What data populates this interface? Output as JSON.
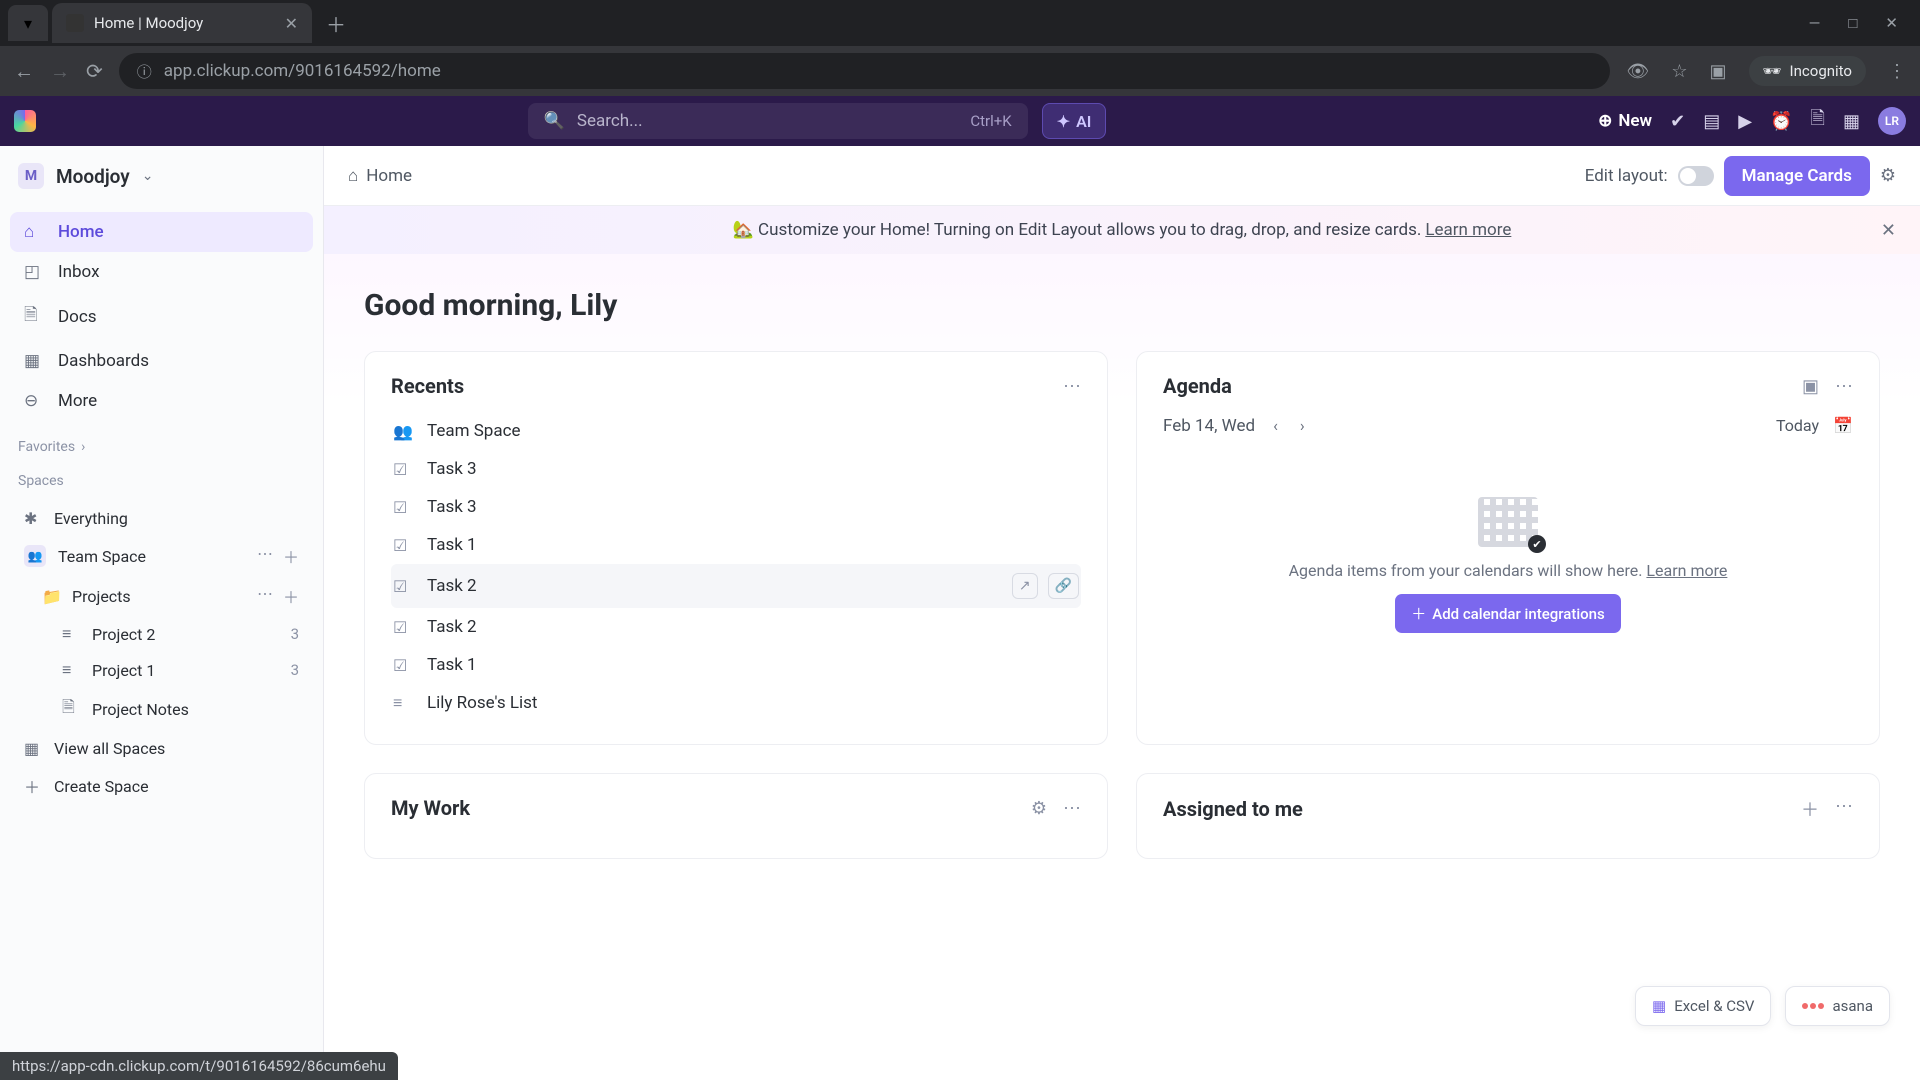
{
  "browser": {
    "tab_title": "Home | Moodjoy",
    "url": "app.clickup.com/9016164592/home",
    "incognito_label": "Incognito",
    "status_url": "https://app-cdn.clickup.com/t/9016164592/86cum6ehu"
  },
  "header": {
    "search_placeholder": "Search...",
    "search_shortcut": "Ctrl+K",
    "ai_label": "AI",
    "new_label": "New",
    "avatar_initials": "LR"
  },
  "sidebar": {
    "workspace_initial": "M",
    "workspace_name": "Moodjoy",
    "nav": [
      {
        "label": "Home",
        "icon": "home"
      },
      {
        "label": "Inbox",
        "icon": "inbox"
      },
      {
        "label": "Docs",
        "icon": "doc"
      },
      {
        "label": "Dashboards",
        "icon": "dashboard"
      },
      {
        "label": "More",
        "icon": "more"
      }
    ],
    "favorites_label": "Favorites",
    "spaces_label": "Spaces",
    "everything_label": "Everything",
    "team_space_label": "Team Space",
    "projects_label": "Projects",
    "project2_label": "Project 2",
    "project2_count": "3",
    "project1_label": "Project 1",
    "project1_count": "3",
    "project_notes_label": "Project Notes",
    "view_all_label": "View all Spaces",
    "create_space_label": "Create Space"
  },
  "breadcrumb": {
    "home": "Home",
    "edit_layout_label": "Edit layout:",
    "manage_cards": "Manage Cards"
  },
  "banner": {
    "emoji": "🏡",
    "text": "Customize your Home! Turning on Edit Layout allows you to drag, drop, and resize cards.",
    "learn_more": "Learn more"
  },
  "greeting": "Good morning, Lily",
  "recents": {
    "title": "Recents",
    "items": [
      {
        "type": "space",
        "label": "Team Space"
      },
      {
        "type": "task",
        "label": "Task 3"
      },
      {
        "type": "task",
        "label": "Task 3"
      },
      {
        "type": "task",
        "label": "Task 1"
      },
      {
        "type": "task",
        "label": "Task 2",
        "hovered": true
      },
      {
        "type": "task",
        "label": "Task 2"
      },
      {
        "type": "task",
        "label": "Task 1"
      },
      {
        "type": "list",
        "label": "Lily Rose's List"
      }
    ]
  },
  "agenda": {
    "title": "Agenda",
    "date": "Feb 14, Wed",
    "today_label": "Today",
    "empty_text": "Agenda items from your calendars will show here.",
    "empty_learn_more": "Learn more",
    "add_button": "Add calendar integrations"
  },
  "mywork": {
    "title": "My Work"
  },
  "assigned": {
    "title": "Assigned to me"
  },
  "float": {
    "excel_label": "Excel & CSV",
    "asana_label": "asana"
  }
}
